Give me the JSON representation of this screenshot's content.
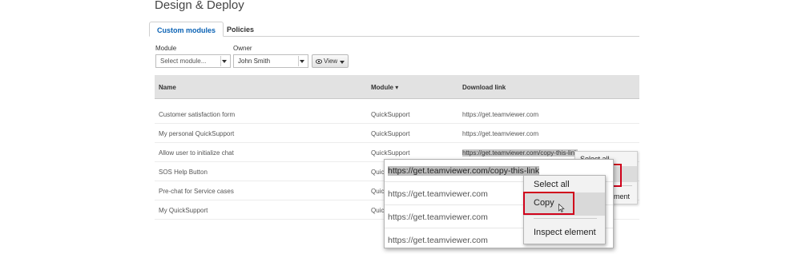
{
  "page": {
    "title": "Design & Deploy"
  },
  "tabs": [
    {
      "label": "Custom modules",
      "active": true
    },
    {
      "label": "Policies",
      "active": false
    }
  ],
  "filters": {
    "module_label": "Module",
    "module_placeholder": "Select module...",
    "owner_label": "Owner",
    "owner_value": "John Smith",
    "view_label": "View"
  },
  "table": {
    "columns": [
      "Name",
      "Module ▾",
      "Download link"
    ],
    "rows": [
      {
        "name": "Customer satisfaction form",
        "module": "QuickSupport",
        "link": "https://get.teamviewer.com"
      },
      {
        "name": "My personal QuickSupport",
        "module": "QuickSupport",
        "link": "https://get.teamviewer.com"
      },
      {
        "name": "Allow user to initialize chat",
        "module": "QuickSupport",
        "link": "https://get.teamviewer.com/copy-this-link"
      },
      {
        "name": "SOS Help Button",
        "module": "Quic",
        "link": ""
      },
      {
        "name": "Pre-chat for Service cases",
        "module": "Quic",
        "link": ""
      },
      {
        "name": "My QuickSupport",
        "module": "Quic",
        "link": ""
      }
    ]
  },
  "bg_menu": {
    "select_all": "Select all",
    "inspect_partial": "element"
  },
  "zoom": {
    "rows": [
      "https://get.teamviewer.com/copy-this-link",
      "https://get.teamviewer.com",
      "https://get.teamviewer.com",
      "https://get.teamviewer.com"
    ]
  },
  "context_menu": {
    "select_all": "Select all",
    "copy": "Copy",
    "inspect": "Inspect element"
  },
  "colors": {
    "accent": "#0a62b4",
    "highlight_border": "#d0021b",
    "header_bg": "#e2e2e2"
  }
}
